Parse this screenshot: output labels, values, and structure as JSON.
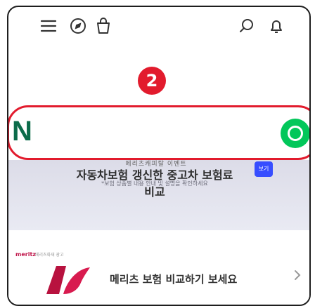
{
  "step": {
    "number": "2"
  },
  "topbar": {
    "icons": [
      "menu-icon",
      "safari-icon",
      "bag-icon",
      "search-icon",
      "bell-icon"
    ]
  },
  "nbar": {
    "logo": "N",
    "accent": "#e21b2d",
    "green": "#02c75a"
  },
  "banner": {
    "top_text": "메리츠캐피탈 이벤트",
    "headline": "자동차보험 갱신한 중고차 보험료 비교",
    "subline": "*보험 상품별 내용 안내 및 설명을 확인하세요",
    "chip": "보기"
  },
  "ad": {
    "brand": "meritz",
    "brand_tail": "메리츠화재 광고",
    "text": "메리츠 보험 비교하기 보세요",
    "brand_color": "#c0154a"
  }
}
